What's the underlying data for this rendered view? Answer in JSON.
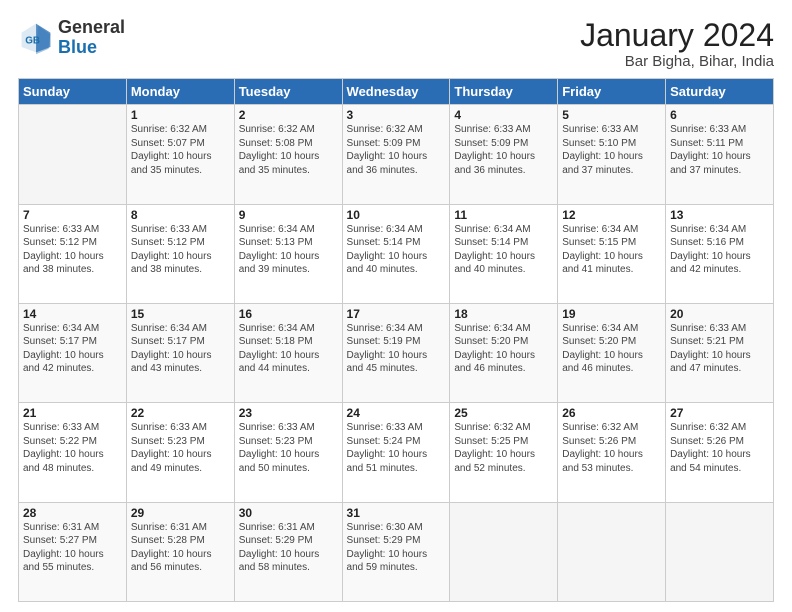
{
  "header": {
    "logo_general": "General",
    "logo_blue": "Blue",
    "main_title": "January 2024",
    "sub_title": "Bar Bigha, Bihar, India"
  },
  "calendar": {
    "headers": [
      "Sunday",
      "Monday",
      "Tuesday",
      "Wednesday",
      "Thursday",
      "Friday",
      "Saturday"
    ],
    "weeks": [
      [
        {
          "day": "",
          "info": ""
        },
        {
          "day": "1",
          "info": "Sunrise: 6:32 AM\nSunset: 5:07 PM\nDaylight: 10 hours\nand 35 minutes."
        },
        {
          "day": "2",
          "info": "Sunrise: 6:32 AM\nSunset: 5:08 PM\nDaylight: 10 hours\nand 35 minutes."
        },
        {
          "day": "3",
          "info": "Sunrise: 6:32 AM\nSunset: 5:09 PM\nDaylight: 10 hours\nand 36 minutes."
        },
        {
          "day": "4",
          "info": "Sunrise: 6:33 AM\nSunset: 5:09 PM\nDaylight: 10 hours\nand 36 minutes."
        },
        {
          "day": "5",
          "info": "Sunrise: 6:33 AM\nSunset: 5:10 PM\nDaylight: 10 hours\nand 37 minutes."
        },
        {
          "day": "6",
          "info": "Sunrise: 6:33 AM\nSunset: 5:11 PM\nDaylight: 10 hours\nand 37 minutes."
        }
      ],
      [
        {
          "day": "7",
          "info": "Sunrise: 6:33 AM\nSunset: 5:12 PM\nDaylight: 10 hours\nand 38 minutes."
        },
        {
          "day": "8",
          "info": "Sunrise: 6:33 AM\nSunset: 5:12 PM\nDaylight: 10 hours\nand 38 minutes."
        },
        {
          "day": "9",
          "info": "Sunrise: 6:34 AM\nSunset: 5:13 PM\nDaylight: 10 hours\nand 39 minutes."
        },
        {
          "day": "10",
          "info": "Sunrise: 6:34 AM\nSunset: 5:14 PM\nDaylight: 10 hours\nand 40 minutes."
        },
        {
          "day": "11",
          "info": "Sunrise: 6:34 AM\nSunset: 5:14 PM\nDaylight: 10 hours\nand 40 minutes."
        },
        {
          "day": "12",
          "info": "Sunrise: 6:34 AM\nSunset: 5:15 PM\nDaylight: 10 hours\nand 41 minutes."
        },
        {
          "day": "13",
          "info": "Sunrise: 6:34 AM\nSunset: 5:16 PM\nDaylight: 10 hours\nand 42 minutes."
        }
      ],
      [
        {
          "day": "14",
          "info": "Sunrise: 6:34 AM\nSunset: 5:17 PM\nDaylight: 10 hours\nand 42 minutes."
        },
        {
          "day": "15",
          "info": "Sunrise: 6:34 AM\nSunset: 5:17 PM\nDaylight: 10 hours\nand 43 minutes."
        },
        {
          "day": "16",
          "info": "Sunrise: 6:34 AM\nSunset: 5:18 PM\nDaylight: 10 hours\nand 44 minutes."
        },
        {
          "day": "17",
          "info": "Sunrise: 6:34 AM\nSunset: 5:19 PM\nDaylight: 10 hours\nand 45 minutes."
        },
        {
          "day": "18",
          "info": "Sunrise: 6:34 AM\nSunset: 5:20 PM\nDaylight: 10 hours\nand 46 minutes."
        },
        {
          "day": "19",
          "info": "Sunrise: 6:34 AM\nSunset: 5:20 PM\nDaylight: 10 hours\nand 46 minutes."
        },
        {
          "day": "20",
          "info": "Sunrise: 6:33 AM\nSunset: 5:21 PM\nDaylight: 10 hours\nand 47 minutes."
        }
      ],
      [
        {
          "day": "21",
          "info": "Sunrise: 6:33 AM\nSunset: 5:22 PM\nDaylight: 10 hours\nand 48 minutes."
        },
        {
          "day": "22",
          "info": "Sunrise: 6:33 AM\nSunset: 5:23 PM\nDaylight: 10 hours\nand 49 minutes."
        },
        {
          "day": "23",
          "info": "Sunrise: 6:33 AM\nSunset: 5:23 PM\nDaylight: 10 hours\nand 50 minutes."
        },
        {
          "day": "24",
          "info": "Sunrise: 6:33 AM\nSunset: 5:24 PM\nDaylight: 10 hours\nand 51 minutes."
        },
        {
          "day": "25",
          "info": "Sunrise: 6:32 AM\nSunset: 5:25 PM\nDaylight: 10 hours\nand 52 minutes."
        },
        {
          "day": "26",
          "info": "Sunrise: 6:32 AM\nSunset: 5:26 PM\nDaylight: 10 hours\nand 53 minutes."
        },
        {
          "day": "27",
          "info": "Sunrise: 6:32 AM\nSunset: 5:26 PM\nDaylight: 10 hours\nand 54 minutes."
        }
      ],
      [
        {
          "day": "28",
          "info": "Sunrise: 6:31 AM\nSunset: 5:27 PM\nDaylight: 10 hours\nand 55 minutes."
        },
        {
          "day": "29",
          "info": "Sunrise: 6:31 AM\nSunset: 5:28 PM\nDaylight: 10 hours\nand 56 minutes."
        },
        {
          "day": "30",
          "info": "Sunrise: 6:31 AM\nSunset: 5:29 PM\nDaylight: 10 hours\nand 58 minutes."
        },
        {
          "day": "31",
          "info": "Sunrise: 6:30 AM\nSunset: 5:29 PM\nDaylight: 10 hours\nand 59 minutes."
        },
        {
          "day": "",
          "info": ""
        },
        {
          "day": "",
          "info": ""
        },
        {
          "day": "",
          "info": ""
        }
      ]
    ]
  }
}
